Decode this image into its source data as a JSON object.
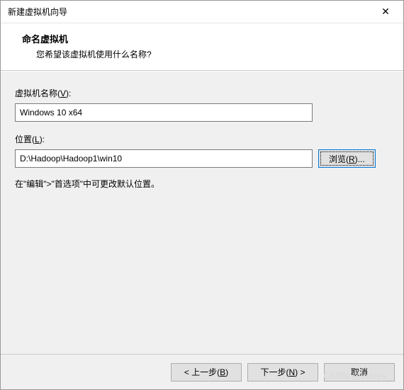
{
  "window": {
    "title": "新建虚拟机向导",
    "close_icon": "✕"
  },
  "header": {
    "title": "命名虚拟机",
    "subtitle": "您希望该虚拟机使用什么名称?"
  },
  "form": {
    "name_label_pre": "虚拟机名称(",
    "name_label_u": "V",
    "name_label_post": "):",
    "name_value": "Windows 10 x64",
    "location_label_pre": "位置(",
    "location_label_u": "L",
    "location_label_post": "):",
    "location_value": "D:\\Hadoop\\Hadoop1\\win10",
    "browse_pre": "浏览(",
    "browse_u": "R",
    "browse_post": ")...",
    "hint": "在\"编辑\">\"首选项\"中可更改默认位置。"
  },
  "footer": {
    "back_pre": "< 上一步(",
    "back_u": "B",
    "back_post": ")",
    "next_pre": "下一步(",
    "next_u": "N",
    "next_post": ") >",
    "cancel": "取消"
  },
  "watermark": "CSDN @Lorrey_"
}
